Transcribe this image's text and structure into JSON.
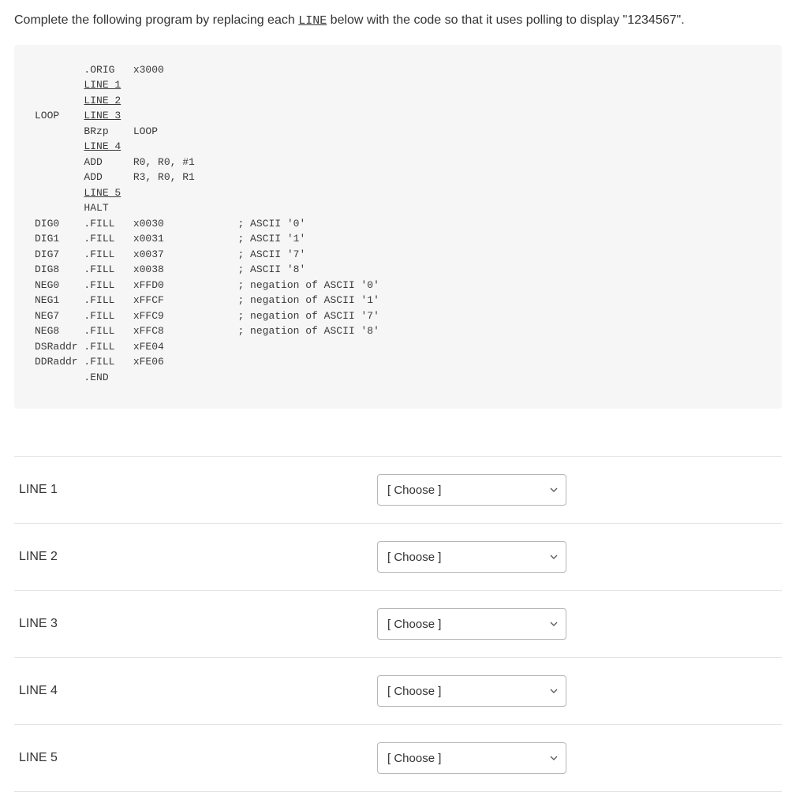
{
  "question": {
    "prefix": "Complete the following program by replacing each ",
    "code_word": "LINE",
    "suffix": " below with the code so that it uses polling to display \"1234567\"."
  },
  "code": {
    "lines": [
      {
        "label": "",
        "op": ".ORIG",
        "args": "x3000",
        "comment": "",
        "ul_op": false
      },
      {
        "label": "",
        "op": "LINE 1",
        "args": "",
        "comment": "",
        "ul_op": true
      },
      {
        "label": "",
        "op": "LINE 2",
        "args": "",
        "comment": "",
        "ul_op": true
      },
      {
        "label": "LOOP",
        "op": "LINE 3",
        "args": "",
        "comment": "",
        "ul_op": true
      },
      {
        "label": "",
        "op": "BRzp",
        "args": "LOOP",
        "comment": "",
        "ul_op": false
      },
      {
        "label": "",
        "op": "LINE 4",
        "args": "",
        "comment": "",
        "ul_op": true
      },
      {
        "label": "",
        "op": "ADD",
        "args": "R0, R0, #1",
        "comment": "",
        "ul_op": false
      },
      {
        "label": "",
        "op": "ADD",
        "args": "R3, R0, R1",
        "comment": "",
        "ul_op": false
      },
      {
        "label": "",
        "op": "LINE 5",
        "args": "",
        "comment": "",
        "ul_op": true
      },
      {
        "label": "",
        "op": "HALT",
        "args": "",
        "comment": "",
        "ul_op": false
      },
      {
        "label": "DIG0",
        "op": ".FILL",
        "args": "x0030",
        "comment": "; ASCII '0'",
        "ul_op": false
      },
      {
        "label": "DIG1",
        "op": ".FILL",
        "args": "x0031",
        "comment": "; ASCII '1'",
        "ul_op": false
      },
      {
        "label": "DIG7",
        "op": ".FILL",
        "args": "x0037",
        "comment": "; ASCII '7'",
        "ul_op": false
      },
      {
        "label": "DIG8",
        "op": ".FILL",
        "args": "x0038",
        "comment": "; ASCII '8'",
        "ul_op": false
      },
      {
        "label": "NEG0",
        "op": ".FILL",
        "args": "xFFD0",
        "comment": "; negation of ASCII '0'",
        "ul_op": false
      },
      {
        "label": "NEG1",
        "op": ".FILL",
        "args": "xFFCF",
        "comment": "; negation of ASCII '1'",
        "ul_op": false
      },
      {
        "label": "NEG7",
        "op": ".FILL",
        "args": "xFFC9",
        "comment": "; negation of ASCII '7'",
        "ul_op": false
      },
      {
        "label": "NEG8",
        "op": ".FILL",
        "args": "xFFC8",
        "comment": "; negation of ASCII '8'",
        "ul_op": false
      },
      {
        "label": "DSRaddr",
        "op": ".FILL",
        "args": "xFE04",
        "comment": "",
        "ul_op": false
      },
      {
        "label": "DDRaddr",
        "op": ".FILL",
        "args": "xFE06",
        "comment": "",
        "ul_op": false
      },
      {
        "label": "",
        "op": ".END",
        "args": "",
        "comment": "",
        "ul_op": false
      }
    ]
  },
  "answers": [
    {
      "label": "LINE 1",
      "selected": "[ Choose ]"
    },
    {
      "label": "LINE 2",
      "selected": "[ Choose ]"
    },
    {
      "label": "LINE 3",
      "selected": "[ Choose ]"
    },
    {
      "label": "LINE 4",
      "selected": "[ Choose ]"
    },
    {
      "label": "LINE 5",
      "selected": "[ Choose ]"
    }
  ]
}
